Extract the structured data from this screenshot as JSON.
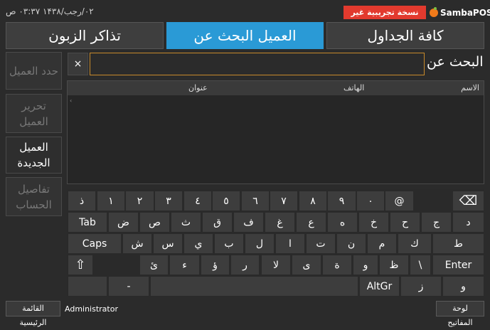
{
  "topbar": {
    "date": "۰۲/رجب/۱۴۳۸ ۰۳:۳۷ ص",
    "trial_badge": "نسخة تجريبية غير مسجلة",
    "logo_text": "SambaPOS"
  },
  "tabs": {
    "tickets": "تذاكر الزبون",
    "search_customer": "العميل البحث عن",
    "all_tables": "كافة الجداول"
  },
  "sidebar": {
    "select_customer": "حدد العميل",
    "edit_customer": "تحرير العميل",
    "new_customer": "العميل الجديدة",
    "account_details": "تفاصيل الحساب"
  },
  "search": {
    "label": "البحث عن",
    "value": "",
    "clear": "×"
  },
  "grid": {
    "col_name": "الاسم",
    "col_phone": "الهاتف",
    "col_address": "عنوان",
    "mark": "‹"
  },
  "keyboard": {
    "row1": [
      "ذ",
      "١",
      "٢",
      "٣",
      "٤",
      "٥",
      "٦",
      "٧",
      "٨",
      "٩",
      "٠",
      "@",
      "⌫"
    ],
    "row2": [
      "Tab",
      "ض",
      "ص",
      "ث",
      "ق",
      "ف",
      "غ",
      "ع",
      "ه",
      "خ",
      "ح",
      "ج",
      "د"
    ],
    "row3": [
      "Caps",
      "ش",
      "س",
      "ي",
      "ب",
      "ل",
      "ا",
      "ت",
      "ن",
      "م",
      "ك",
      "ط"
    ],
    "row4": [
      "⇧",
      "ئ",
      "ء",
      "ؤ",
      "ر",
      "لا",
      "ى",
      "ة",
      "و",
      "ظ",
      "\\",
      "Enter"
    ],
    "row5": [
      "-",
      "AltGr",
      "ز",
      "و"
    ]
  },
  "footer": {
    "main_menu": "القائمة الرئيسية",
    "user": "Administrator",
    "keyboard": "لوحة المفاتيح"
  },
  "colors": {
    "accent": "#2a9ad6",
    "trial_bg": "#e23a2e",
    "input_border": "#c88a2a"
  }
}
